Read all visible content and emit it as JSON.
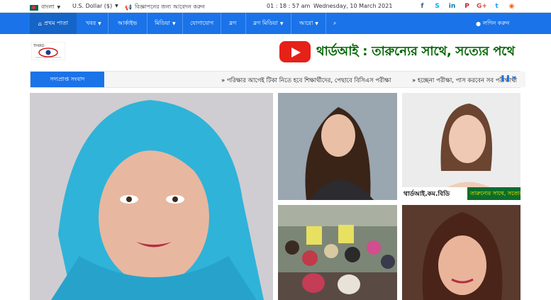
{
  "topbar": {
    "language": "বাংলা",
    "currency": "U.S. Dollar ($)",
    "advertise": "বিজ্ঞাপনের জন্য আবেদন করুন",
    "time": "01 : 18 : 57 am",
    "date": "Wednesday, 10 March 2021",
    "social": [
      {
        "icon": "facebook-icon",
        "glyph": "f",
        "color": "#3b5998"
      },
      {
        "icon": "skype-icon",
        "glyph": "S",
        "color": "#00aff0"
      },
      {
        "icon": "linkedin-icon",
        "glyph": "in",
        "color": "#0077b5"
      },
      {
        "icon": "pinterest-icon",
        "glyph": "P",
        "color": "#cb2027"
      },
      {
        "icon": "google-plus-icon",
        "glyph": "G+",
        "color": "#dd4b39"
      },
      {
        "icon": "twitter-icon",
        "glyph": "t",
        "color": "#1da1f2"
      },
      {
        "icon": "rss-icon",
        "glyph": "◉",
        "color": "#f26522"
      }
    ]
  },
  "nav": {
    "home": "প্রথম পাতা",
    "items": [
      "খবর",
      "আর্কাইভ",
      "মিডিয়া",
      "যোগাযোগ",
      "ব্লগ",
      "ব্লগ মিডিয়া",
      "আরো"
    ],
    "login": "লগিন করুন",
    "accent": "#1a73e8"
  },
  "logo": {
    "text": "THIRD"
  },
  "banner": {
    "text": "থার্ডআই : তারুন্যের সাথে, সত্যের পথে"
  },
  "ticker": {
    "label": "সদ্যপ্রাপ্ত সংবাদ",
    "news": [
      "পরিক্ষার আগেই টিকা নিতে হবে শিক্ষার্থীদের, পেছাবে বিসিএস পরীক্ষা",
      "হচ্ছেনা পরীক্ষা, পাস করবেন সব পরীক্ষার্থী"
    ]
  },
  "photos": {
    "overlay_left": "থার্ডআই.কম.বিডি",
    "overlay_right": "তারুন্যের সাথে, সত্যের পথে"
  }
}
